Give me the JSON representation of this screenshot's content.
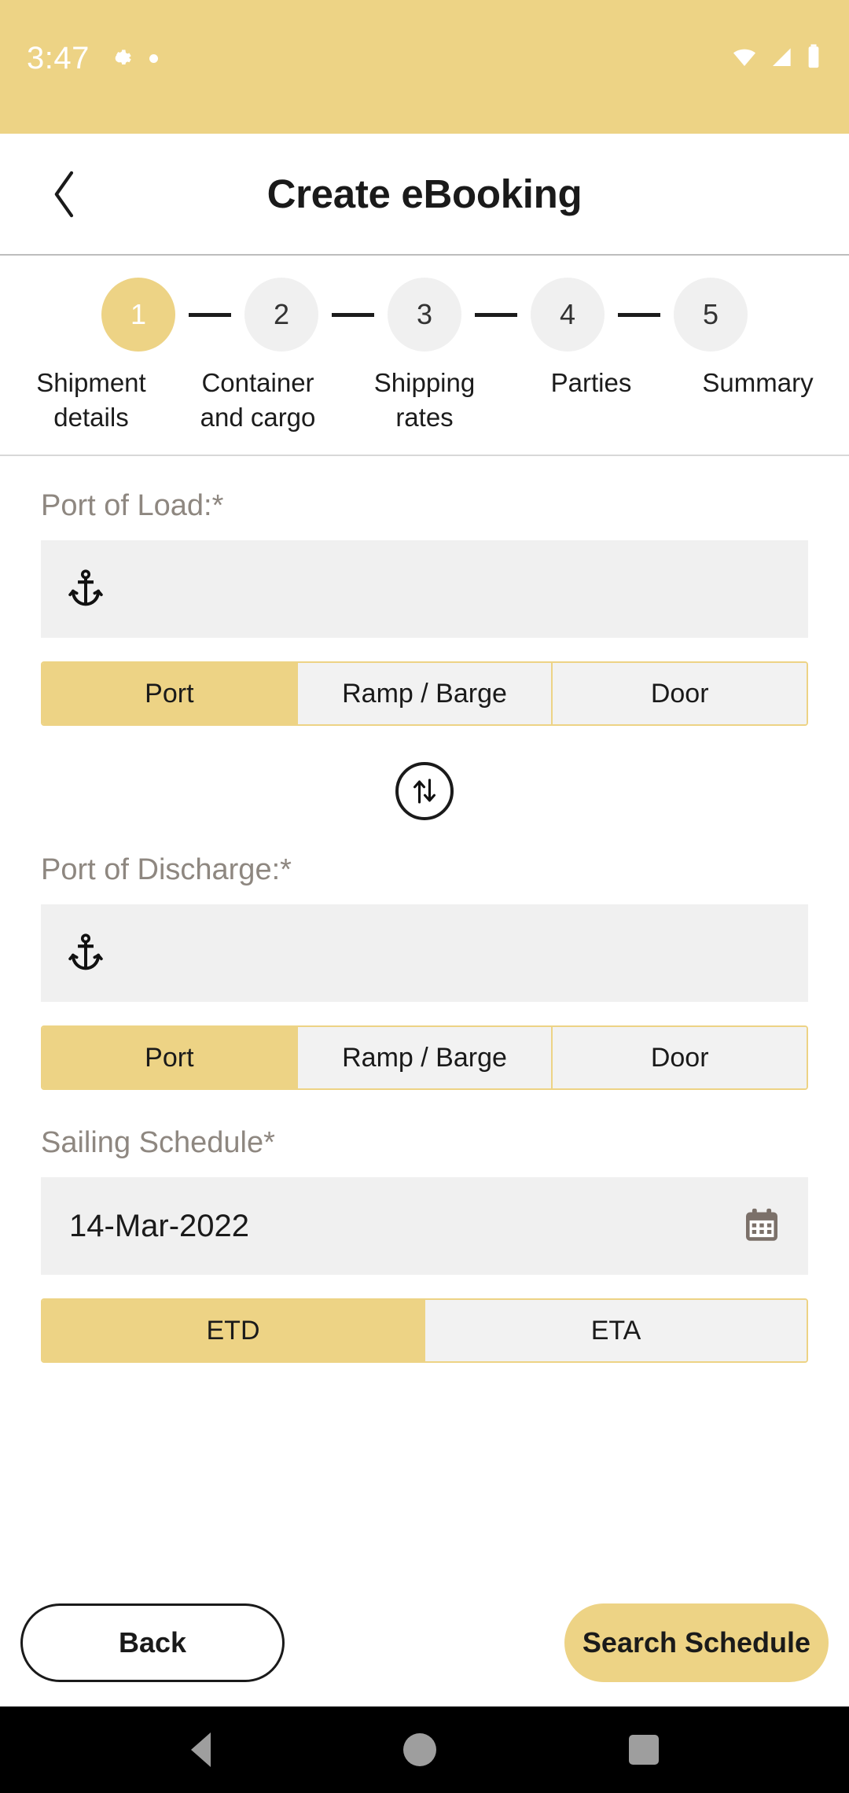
{
  "status_bar": {
    "time": "3:47",
    "left_icons": [
      "gear-icon",
      "dot-icon"
    ],
    "right_icons": [
      "wifi-icon",
      "signal-icon",
      "battery-icon"
    ],
    "background_color": "#EDD385"
  },
  "header": {
    "back_label": "",
    "title": "Create eBooking"
  },
  "stepper": {
    "active_index": 1,
    "steps": [
      {
        "number": "1",
        "label": "Shipment\ndetails"
      },
      {
        "number": "2",
        "label": "Container\nand cargo"
      },
      {
        "number": "3",
        "label": "Shipping\nrates"
      },
      {
        "number": "4",
        "label": "Parties"
      },
      {
        "number": "5",
        "label": "Summary"
      }
    ]
  },
  "form": {
    "port_of_load": {
      "label": "Port of Load:*",
      "value": "",
      "placeholder": "",
      "icon": "anchor-icon",
      "options": [
        "Port",
        "Ramp / Barge",
        "Door"
      ],
      "selected": "Port"
    },
    "swap": {
      "icon": "swap-vertical-icon"
    },
    "port_of_discharge": {
      "label": "Port of Discharge:*",
      "value": "",
      "placeholder": "",
      "icon": "anchor-icon",
      "options": [
        "Port",
        "Ramp / Barge",
        "Door"
      ],
      "selected": "Port"
    },
    "sailing_schedule": {
      "label": "Sailing Schedule*",
      "date_value": "14-Mar-2022",
      "icon": "calendar-icon",
      "options": [
        "ETD",
        "ETA"
      ],
      "selected": "ETD"
    }
  },
  "footer": {
    "back_label": "Back",
    "search_label": "Search Schedule"
  },
  "navbar": {
    "back": "nav-back-icon",
    "home": "nav-home-icon",
    "recents": "nav-recents-icon"
  },
  "colors": {
    "accent": "#EDD385",
    "field_bg": "#F0F0F0",
    "label_text": "#8E8780",
    "body_text": "#1A1A1A"
  }
}
